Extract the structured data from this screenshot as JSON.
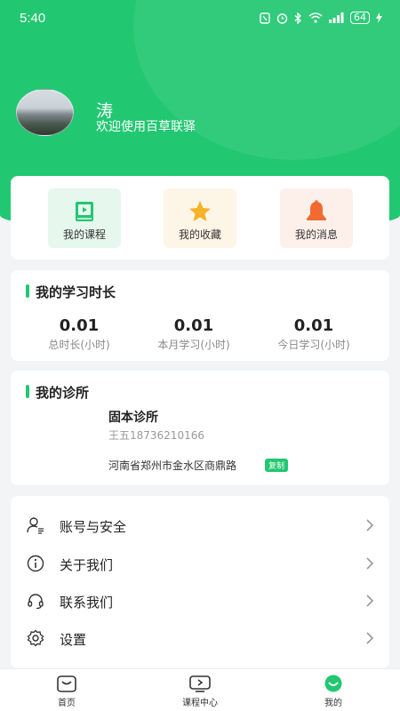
{
  "status_bar": {
    "time": "5:40",
    "battery": "64"
  },
  "profile": {
    "name": "涛",
    "welcome": "欢迎使用百草联驿"
  },
  "quick_actions": [
    {
      "label": "我的课程",
      "icon": "course-book-icon",
      "bg": "#e6f7ee"
    },
    {
      "label": "我的收藏",
      "icon": "star-icon",
      "bg": "#fdf5e6"
    },
    {
      "label": "我的消息",
      "icon": "bell-icon",
      "bg": "#fdf0eb"
    }
  ],
  "study": {
    "title": "我的学习时长",
    "stats": [
      {
        "value": "0.01",
        "label": "总时长(小时)"
      },
      {
        "value": "0.01",
        "label": "本月学习(小时)"
      },
      {
        "value": "0.01",
        "label": "今日学习(小时)"
      }
    ]
  },
  "clinic": {
    "title": "我的诊所",
    "name": "固本诊所",
    "contact": "王五18736210166",
    "address": "河南省郑州市金水区商鼎路",
    "copy_label": "复制"
  },
  "menu": [
    {
      "label": "账号与安全",
      "icon": "user-security-icon"
    },
    {
      "label": "关于我们",
      "icon": "info-icon"
    },
    {
      "label": "联系我们",
      "icon": "headset-icon"
    },
    {
      "label": "设置",
      "icon": "gear-icon"
    }
  ],
  "tabs": [
    {
      "label": "首页",
      "icon": "home-icon"
    },
    {
      "label": "课程中心",
      "icon": "play-screen-icon"
    },
    {
      "label": "我的",
      "icon": "profile-icon",
      "active": true
    }
  ],
  "colors": {
    "brand": "#22c772",
    "star": "#f6b22a",
    "bell": "#f26a2f"
  }
}
